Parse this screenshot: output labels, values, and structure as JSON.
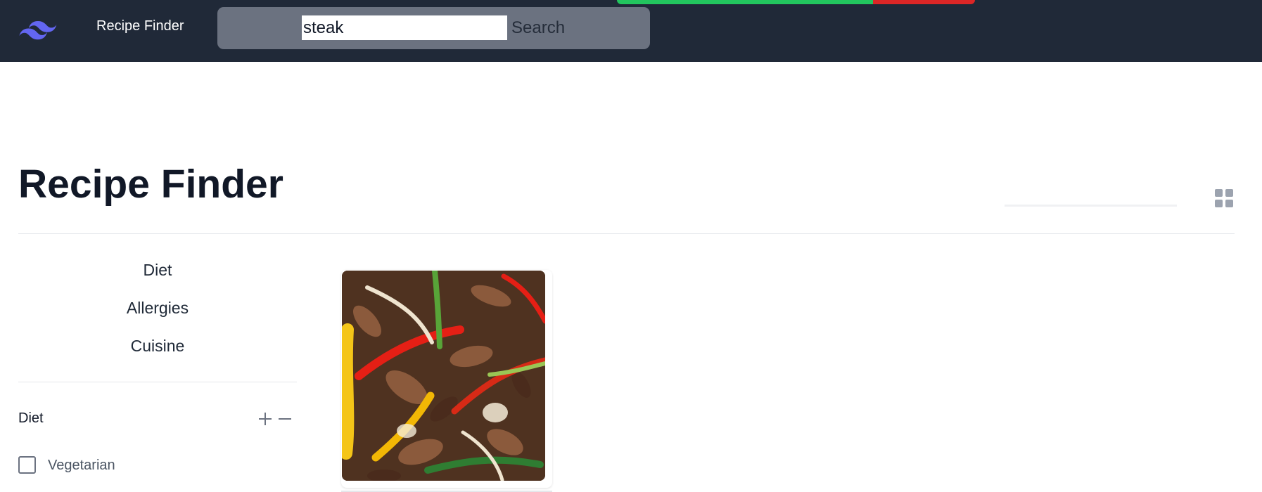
{
  "navbar": {
    "brand": "Recipe Finder",
    "logo_icon": "tailwind-wave-icon",
    "accent_color": "#6366f1",
    "background_color": "#202938"
  },
  "search": {
    "value": "steak",
    "button_label": "Search"
  },
  "status_strip": {
    "green_color": "#22c55e",
    "red_color": "#dc2626"
  },
  "page": {
    "title": "Recipe Finder"
  },
  "view_toggle": {
    "icon": "grid-view-icon"
  },
  "sidebar": {
    "categories": [
      {
        "label": "Diet"
      },
      {
        "label": "Allergies"
      },
      {
        "label": "Cuisine"
      }
    ],
    "sections": [
      {
        "title": "Diet",
        "expand_icon": "plus-icon",
        "collapse_icon": "minus-icon",
        "options": [
          {
            "label": "Vegetarian",
            "checked": false
          }
        ]
      }
    ]
  },
  "results": [
    {
      "image": "steak-fajitas-photo"
    }
  ]
}
